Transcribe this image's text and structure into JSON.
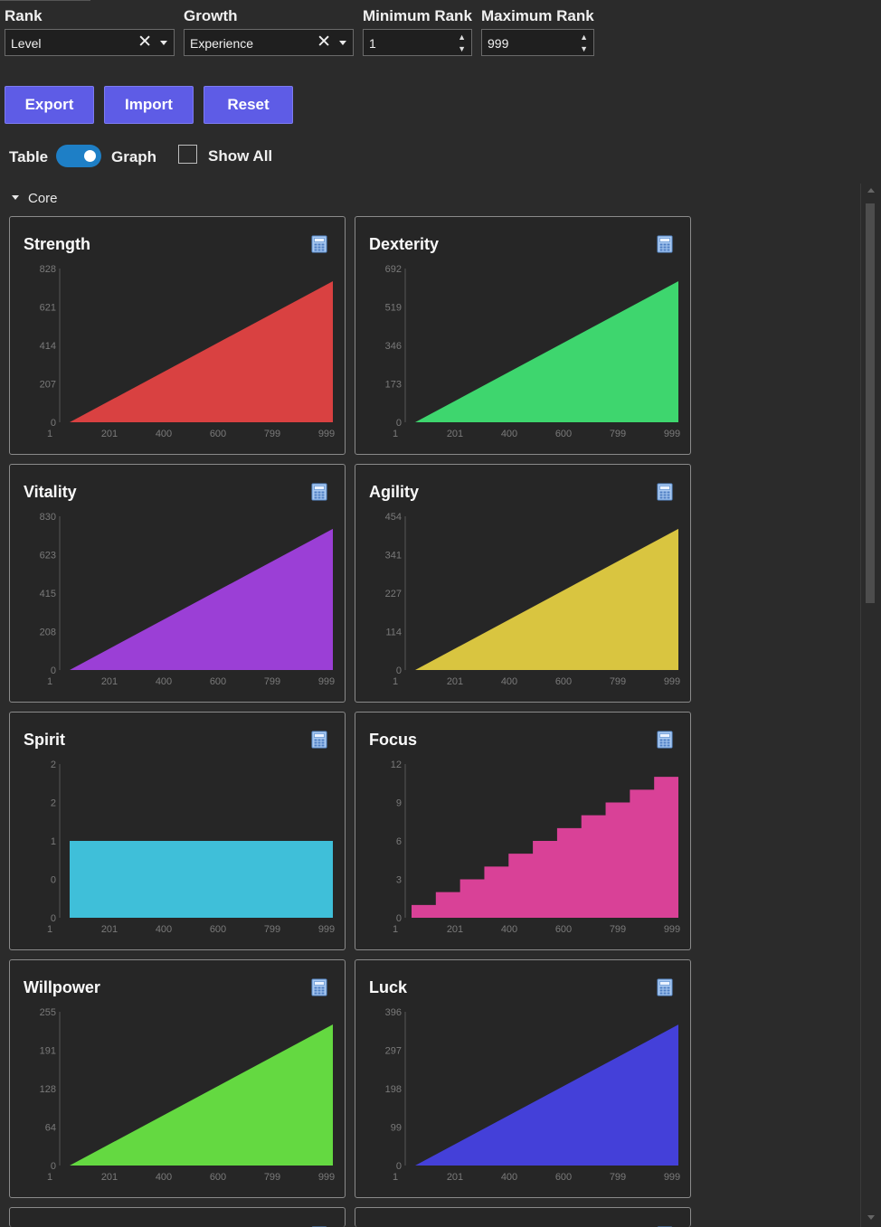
{
  "filters": {
    "rank": {
      "label": "Rank",
      "value": "Level"
    },
    "growth": {
      "label": "Growth",
      "value": "Experience"
    },
    "min_rank": {
      "label": "Minimum Rank",
      "value": "1"
    },
    "max_rank": {
      "label": "Maximum Rank",
      "value": "999"
    }
  },
  "actions": {
    "export": "Export",
    "import": "Import",
    "reset": "Reset"
  },
  "view": {
    "table_label": "Table",
    "graph_label": "Graph",
    "graph_on": true,
    "show_all_label": "Show All",
    "show_all_checked": false
  },
  "section": {
    "label": "Core"
  },
  "chart_data": [
    {
      "type": "area",
      "title": "Strength",
      "color": "#d94141",
      "shape": "linear",
      "x": [
        1,
        999
      ],
      "y": [
        0,
        760
      ],
      "ylim": [
        0,
        828
      ],
      "yticks": [
        "0",
        "207",
        "414",
        "621",
        "828"
      ],
      "xticks": [
        "1",
        "201",
        "400",
        "600",
        "799",
        "999"
      ]
    },
    {
      "type": "area",
      "title": "Dexterity",
      "color": "#3ed66e",
      "shape": "linear",
      "x": [
        1,
        999
      ],
      "y": [
        0,
        635
      ],
      "ylim": [
        0,
        692
      ],
      "yticks": [
        "0",
        "173",
        "346",
        "519",
        "692"
      ],
      "xticks": [
        "1",
        "201",
        "400",
        "600",
        "799",
        "999"
      ]
    },
    {
      "type": "area",
      "title": "Vitality",
      "color": "#9b3fd6",
      "shape": "linear",
      "x": [
        1,
        999
      ],
      "y": [
        0,
        762
      ],
      "ylim": [
        0,
        830
      ],
      "yticks": [
        "0",
        "208",
        "415",
        "623",
        "830"
      ],
      "xticks": [
        "1",
        "201",
        "400",
        "600",
        "799",
        "999"
      ]
    },
    {
      "type": "area",
      "title": "Agility",
      "color": "#d9c540",
      "shape": "linear",
      "x": [
        1,
        999
      ],
      "y": [
        0,
        417
      ],
      "ylim": [
        0,
        454
      ],
      "yticks": [
        "0",
        "114",
        "227",
        "341",
        "454"
      ],
      "xticks": [
        "1",
        "201",
        "400",
        "600",
        "799",
        "999"
      ]
    },
    {
      "type": "area",
      "title": "Spirit",
      "color": "#3fbfd9",
      "shape": "flat",
      "x": [
        1,
        999
      ],
      "y": [
        1,
        1
      ],
      "ylim": [
        0,
        2
      ],
      "yticks": [
        "0",
        "0",
        "1",
        "2",
        "2"
      ],
      "xticks": [
        "1",
        "201",
        "400",
        "600",
        "799",
        "999"
      ]
    },
    {
      "type": "area",
      "title": "Focus",
      "color": "#d94197",
      "shape": "step",
      "x": [
        1,
        999
      ],
      "y": [
        1,
        11
      ],
      "ylim": [
        0,
        12
      ],
      "yticks": [
        "0",
        "3",
        "6",
        "9",
        "12"
      ],
      "xticks": [
        "1",
        "201",
        "400",
        "600",
        "799",
        "999"
      ]
    },
    {
      "type": "area",
      "title": "Willpower",
      "color": "#64d941",
      "shape": "linear",
      "x": [
        1,
        999
      ],
      "y": [
        0,
        234
      ],
      "ylim": [
        0,
        255
      ],
      "yticks": [
        "0",
        "64",
        "128",
        "191",
        "255"
      ],
      "xticks": [
        "1",
        "201",
        "400",
        "600",
        "799",
        "999"
      ]
    },
    {
      "type": "area",
      "title": "Luck",
      "color": "#4440d9",
      "shape": "linear",
      "x": [
        1,
        999
      ],
      "y": [
        0,
        363
      ],
      "ylim": [
        0,
        396
      ],
      "yticks": [
        "0",
        "99",
        "198",
        "297",
        "396"
      ],
      "xticks": [
        "1",
        "201",
        "400",
        "600",
        "799",
        "999"
      ]
    }
  ],
  "icons": {
    "calculator": "calculator-icon",
    "clear": "clear-icon",
    "dropdown": "chevron-down-icon"
  }
}
